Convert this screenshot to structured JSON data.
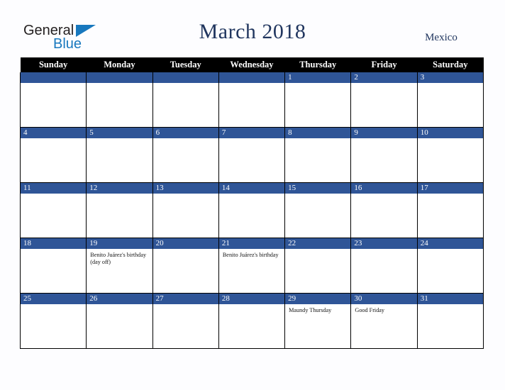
{
  "brand": {
    "name_part1": "General",
    "name_part2": "Blue",
    "triangle_icon": "triangle-icon",
    "primary_color": "#1878be",
    "text_color": "#231f20"
  },
  "header": {
    "title": "March 2018",
    "region": "Mexico",
    "title_color": "#21365f"
  },
  "calendar": {
    "month": "March",
    "year": "2018",
    "country": "Mexico",
    "header_background": "#000000",
    "date_bar_color": "#2f5597",
    "weekday_headers": [
      "Sunday",
      "Monday",
      "Tuesday",
      "Wednesday",
      "Thursday",
      "Friday",
      "Saturday"
    ],
    "weeks": [
      [
        {
          "number": "",
          "events": []
        },
        {
          "number": "",
          "events": []
        },
        {
          "number": "",
          "events": []
        },
        {
          "number": "",
          "events": []
        },
        {
          "number": "1",
          "events": []
        },
        {
          "number": "2",
          "events": []
        },
        {
          "number": "3",
          "events": []
        }
      ],
      [
        {
          "number": "4",
          "events": []
        },
        {
          "number": "5",
          "events": []
        },
        {
          "number": "6",
          "events": []
        },
        {
          "number": "7",
          "events": []
        },
        {
          "number": "8",
          "events": []
        },
        {
          "number": "9",
          "events": []
        },
        {
          "number": "10",
          "events": []
        }
      ],
      [
        {
          "number": "11",
          "events": []
        },
        {
          "number": "12",
          "events": []
        },
        {
          "number": "13",
          "events": []
        },
        {
          "number": "14",
          "events": []
        },
        {
          "number": "15",
          "events": []
        },
        {
          "number": "16",
          "events": []
        },
        {
          "number": "17",
          "events": []
        }
      ],
      [
        {
          "number": "18",
          "events": []
        },
        {
          "number": "19",
          "events": [
            "Benito Juárez's birthday (day off)"
          ]
        },
        {
          "number": "20",
          "events": []
        },
        {
          "number": "21",
          "events": [
            "Benito Juárez's birthday"
          ]
        },
        {
          "number": "22",
          "events": []
        },
        {
          "number": "23",
          "events": []
        },
        {
          "number": "24",
          "events": []
        }
      ],
      [
        {
          "number": "25",
          "events": []
        },
        {
          "number": "26",
          "events": []
        },
        {
          "number": "27",
          "events": []
        },
        {
          "number": "28",
          "events": []
        },
        {
          "number": "29",
          "events": [
            "Maundy Thursday"
          ]
        },
        {
          "number": "30",
          "events": [
            "Good Friday"
          ]
        },
        {
          "number": "31",
          "events": []
        }
      ]
    ]
  }
}
